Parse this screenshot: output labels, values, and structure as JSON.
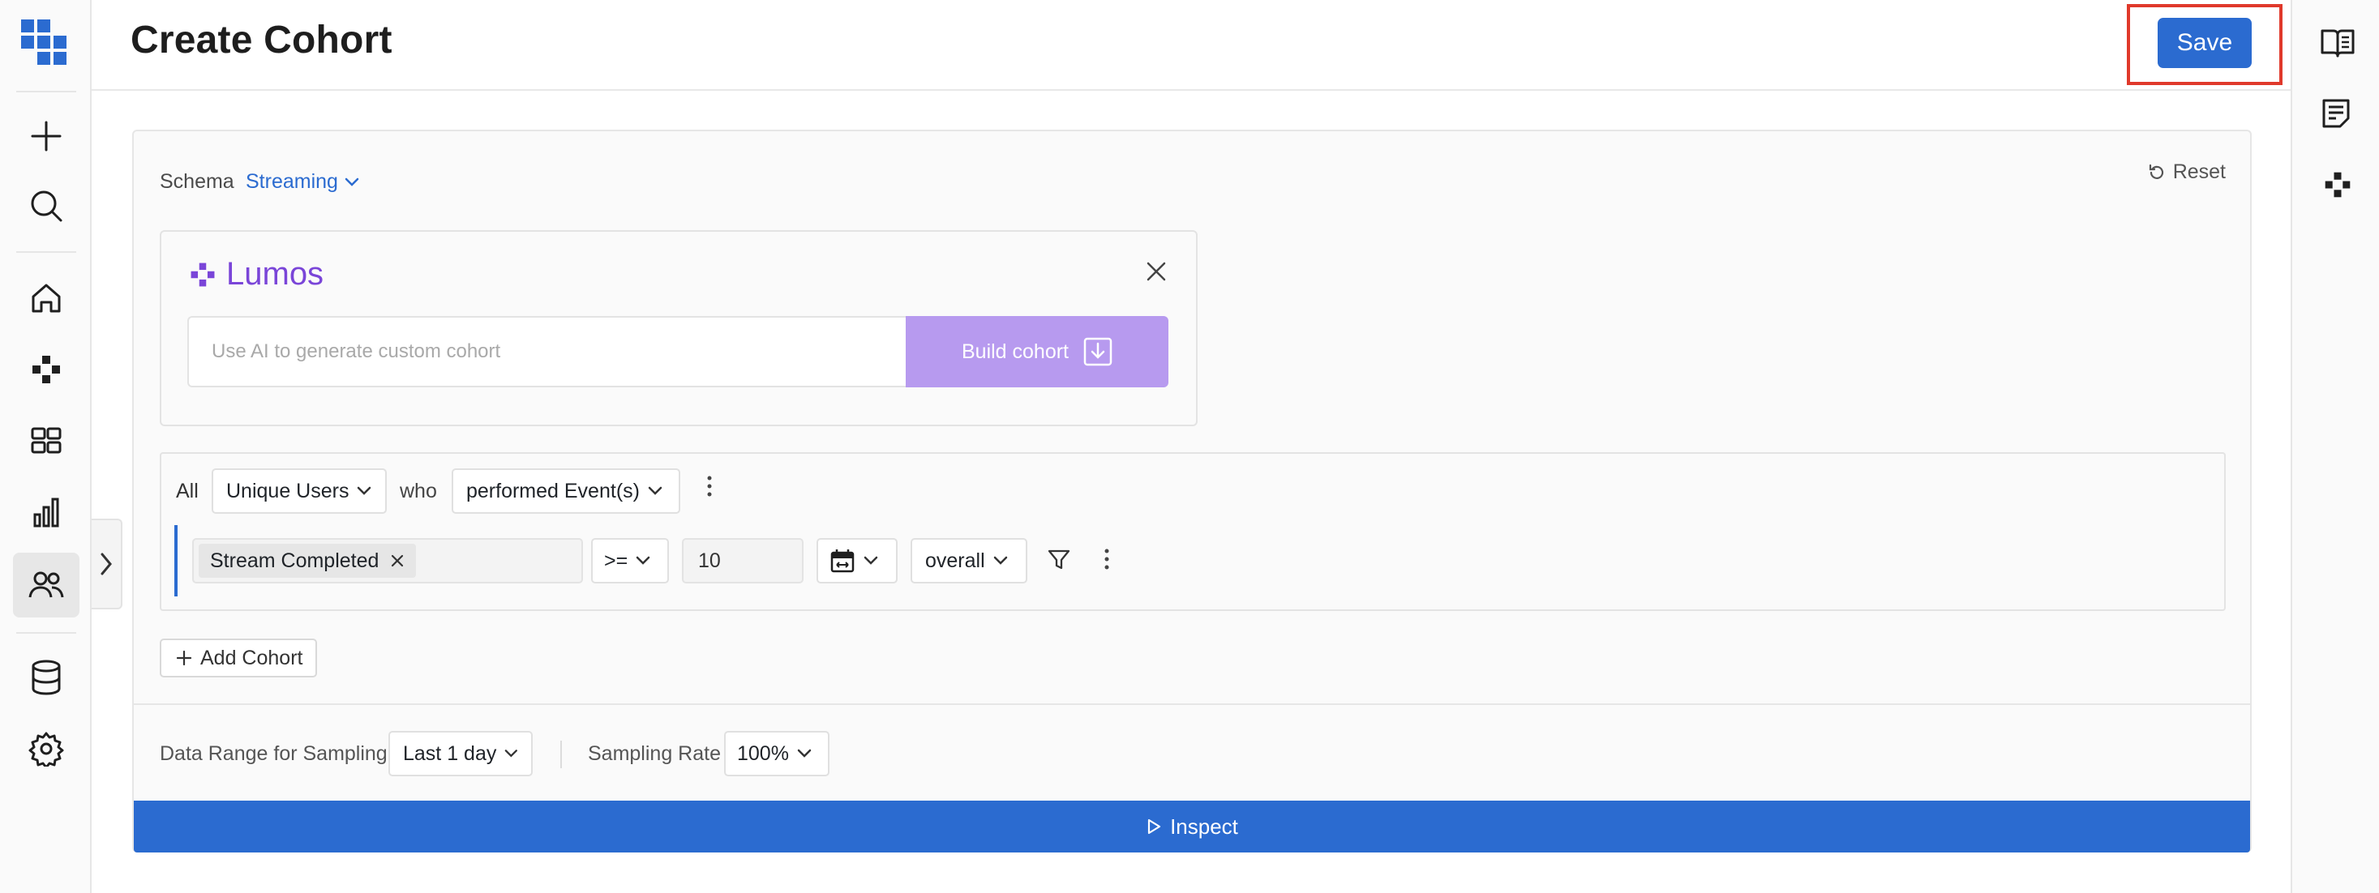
{
  "header": {
    "title": "Create Cohort",
    "save_label": "Save"
  },
  "left_rail": {
    "items": [
      "grid-logo-icon",
      "plus-icon",
      "search-icon",
      "home-icon",
      "lumos-icon",
      "dashboard-icon",
      "chart-icon",
      "cohorts-icon",
      "database-icon",
      "settings-icon"
    ],
    "active": "cohorts-icon"
  },
  "right_rail": {
    "items": [
      "book-icon",
      "notes-icon",
      "lumos-icon"
    ]
  },
  "schema": {
    "label": "Schema",
    "value": "Streaming"
  },
  "reset_label": "Reset",
  "lumos": {
    "brand": "Lumos",
    "placeholder": "Use AI to generate custom cohort",
    "build_label": "Build cohort"
  },
  "cohort": {
    "all_label": "All",
    "users_select": "Unique Users",
    "who_label": "who",
    "action_select": "performed Event(s)",
    "event_chip": "Stream Completed",
    "operator": ">=",
    "count_value": "10",
    "scope_select": "overall"
  },
  "add_cohort_label": "Add Cohort",
  "sampling": {
    "range_label": "Data Range for Sampling",
    "range_value": "Last 1 day",
    "rate_label": "Sampling Rate",
    "rate_value": "100%"
  },
  "inspect_label": "Inspect",
  "colors": {
    "accent": "#2b6bd0",
    "lumos_purple": "#7a45d8",
    "build_button": "#b79aef",
    "highlight": "#e0392b"
  }
}
